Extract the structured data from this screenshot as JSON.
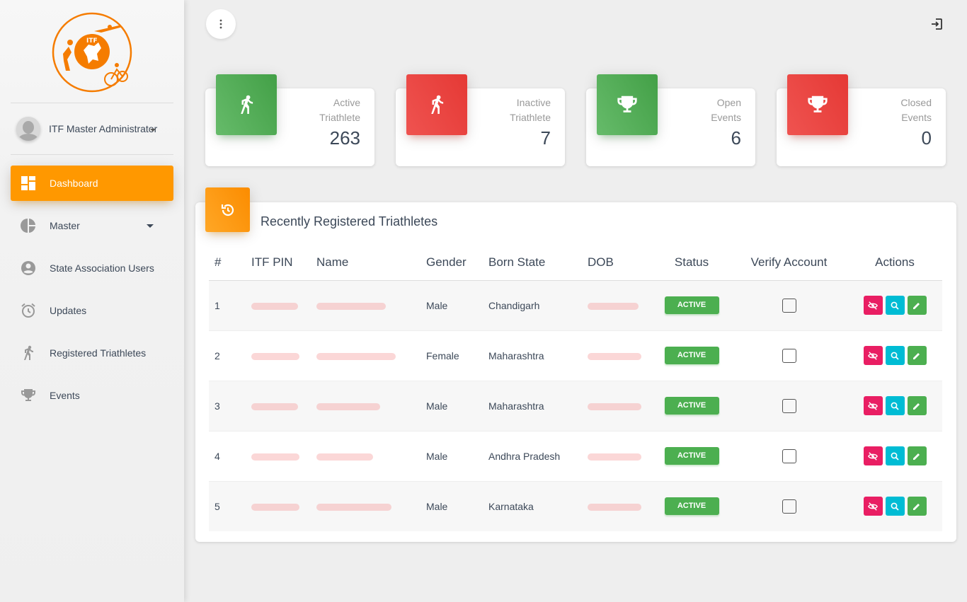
{
  "app": {
    "logo_text": "ITF"
  },
  "user": {
    "name": "ITF Master Administrator"
  },
  "nav": [
    {
      "label": "Dashboard",
      "icon": "dashboard-icon",
      "active": true
    },
    {
      "label": "Master",
      "icon": "pie-chart-icon",
      "has_submenu": true
    },
    {
      "label": "State Association Users",
      "icon": "account-circle-icon"
    },
    {
      "label": "Updates",
      "icon": "alarm-icon"
    },
    {
      "label": "Registered Triathletes",
      "icon": "runner-icon"
    },
    {
      "label": "Events",
      "icon": "trophy-icon"
    }
  ],
  "stats": [
    {
      "label_line1": "Active",
      "label_line2": "Triathlete",
      "value": "263",
      "color": "green",
      "icon": "runner-icon"
    },
    {
      "label_line1": "Inactive",
      "label_line2": "Triathlete",
      "value": "7",
      "color": "red",
      "icon": "runner-icon"
    },
    {
      "label_line1": "Open",
      "label_line2": "Events",
      "value": "6",
      "color": "green",
      "icon": "trophy-icon"
    },
    {
      "label_line1": "Closed",
      "label_line2": "Events",
      "value": "0",
      "color": "red",
      "icon": "trophy-icon"
    }
  ],
  "table": {
    "title": "Recently Registered Triathletes",
    "columns": [
      "#",
      "ITF PIN",
      "Name",
      "Gender",
      "Born State",
      "DOB",
      "Status",
      "Verify Account",
      "Actions"
    ],
    "rows": [
      {
        "num": "1",
        "gender": "Male",
        "state": "Chandigarh",
        "status": "ACTIVE"
      },
      {
        "num": "2",
        "gender": "Female",
        "state": "Maharashtra",
        "status": "ACTIVE"
      },
      {
        "num": "3",
        "gender": "Male",
        "state": "Maharashtra",
        "status": "ACTIVE"
      },
      {
        "num": "4",
        "gender": "Male",
        "state": "Andhra Pradesh",
        "status": "ACTIVE"
      },
      {
        "num": "5",
        "gender": "Male",
        "state": "Karnataka",
        "status": "ACTIVE"
      }
    ]
  },
  "colors": {
    "accent": "#ff9800",
    "green": "#4caf50",
    "red": "#f44336",
    "pink": "#e91e63",
    "cyan": "#00bcd4"
  }
}
